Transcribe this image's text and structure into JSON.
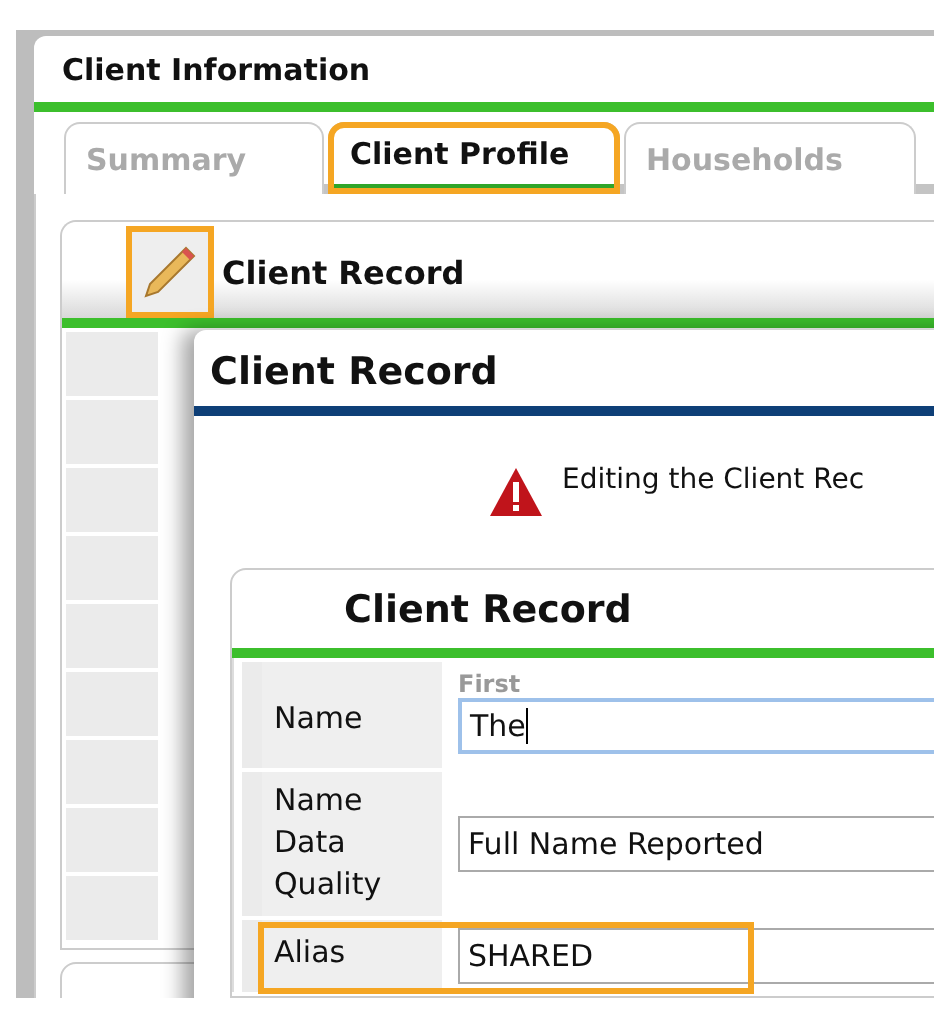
{
  "window": {
    "title": "Client Information"
  },
  "tabs": [
    {
      "label": "Summary",
      "selected": false,
      "highlighted": false
    },
    {
      "label": "Client Profile",
      "selected": true,
      "highlighted": true
    },
    {
      "label": "Households",
      "selected": false,
      "highlighted": false
    }
  ],
  "panel": {
    "title": "Client Record",
    "edit_highlighted": true
  },
  "dialog": {
    "title": "Client Record",
    "warning": "Editing the Client Rec",
    "section_title": "Client Record",
    "fields": [
      {
        "kind": "text",
        "label": "Name",
        "caption": "First",
        "value": "The",
        "focused": true,
        "highlighted": false
      },
      {
        "kind": "select",
        "label": "Name Data Quality",
        "value": "Full Name Reported",
        "focused": false,
        "highlighted": false
      },
      {
        "kind": "text",
        "label": "Alias",
        "value": "SHARED",
        "focused": false,
        "highlighted": true
      }
    ]
  }
}
